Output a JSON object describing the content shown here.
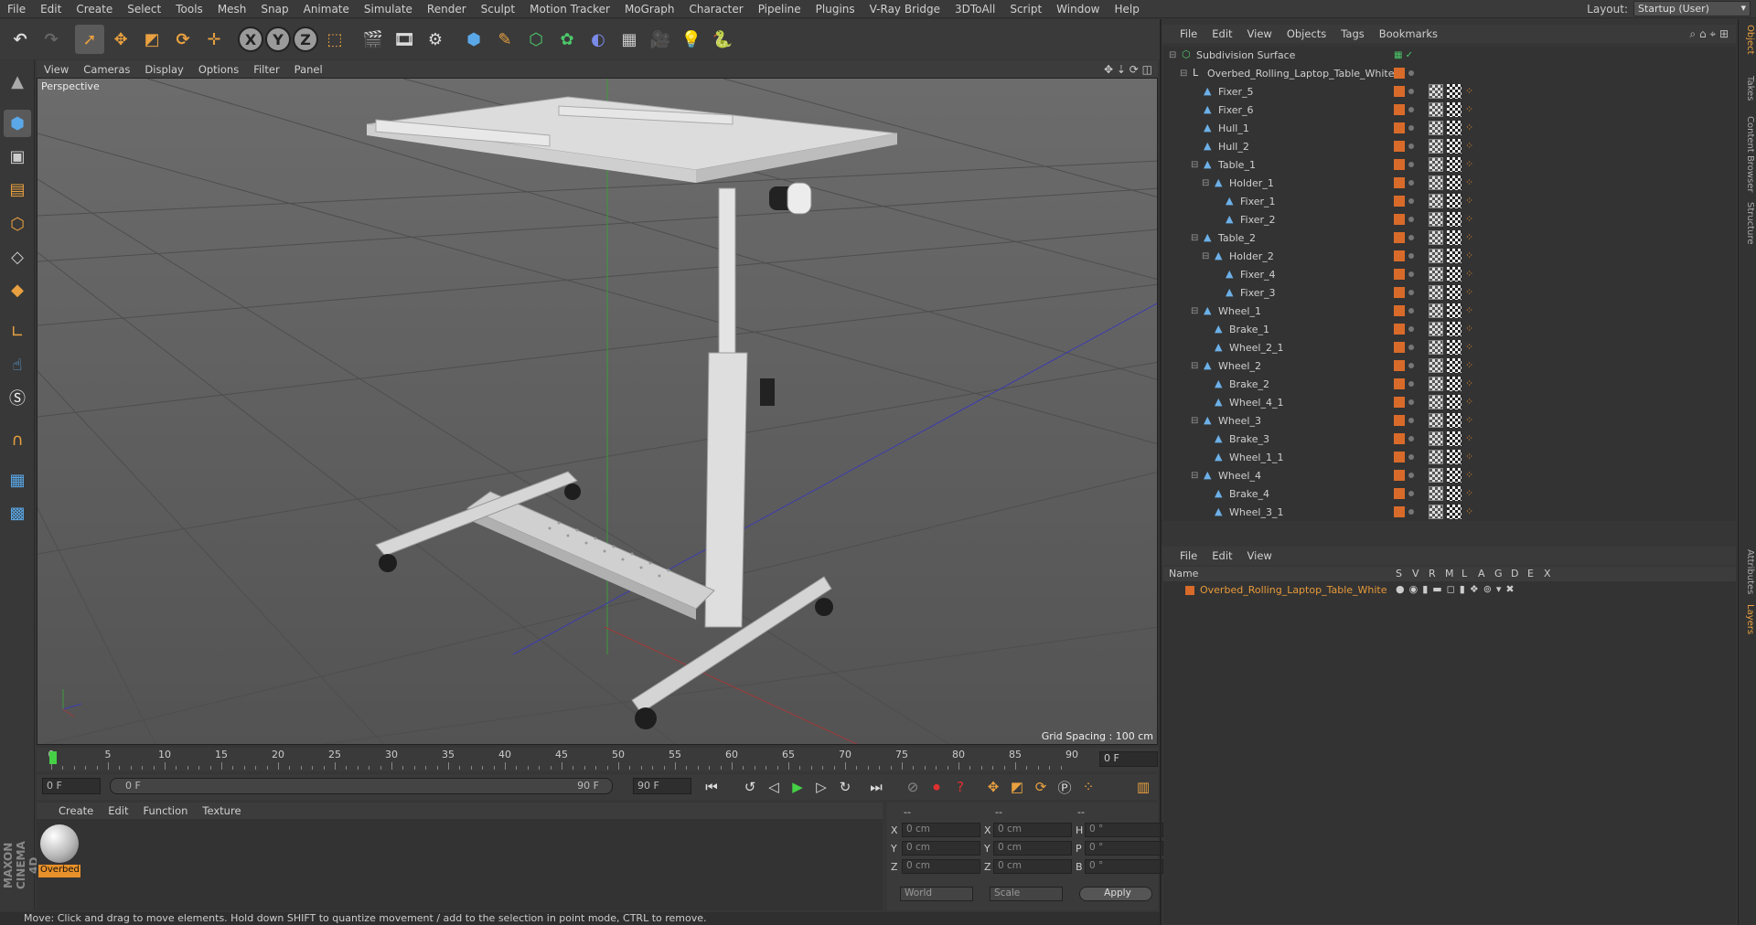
{
  "menubar": {
    "items": [
      "File",
      "Edit",
      "Create",
      "Select",
      "Tools",
      "Mesh",
      "Snap",
      "Animate",
      "Simulate",
      "Render",
      "Sculpt",
      "Motion Tracker",
      "MoGraph",
      "Character",
      "Pipeline",
      "Plugins",
      "V-Ray Bridge",
      "3DToAll",
      "Script",
      "Window",
      "Help"
    ],
    "layout_label": "Layout:",
    "layout_value": "Startup (User)"
  },
  "viewport": {
    "menu": [
      "View",
      "Cameras",
      "Display",
      "Options",
      "Filter",
      "Panel"
    ],
    "label": "Perspective",
    "grid_spacing": "Grid Spacing : 100 cm"
  },
  "timeline": {
    "ticks": [
      "0",
      "5",
      "10",
      "15",
      "20",
      "25",
      "30",
      "35",
      "40",
      "45",
      "50",
      "55",
      "60",
      "65",
      "70",
      "75",
      "80",
      "85",
      "90"
    ],
    "frame_end": "0 F"
  },
  "transport": {
    "current_frame": "0 F",
    "range_start": "0 F",
    "range_end": "90 F",
    "max_frame": "90 F"
  },
  "material_manager": {
    "menu": [
      "Create",
      "Edit",
      "Function",
      "Texture"
    ],
    "material_name": "Overbed"
  },
  "coordinates": {
    "header_a": "--",
    "header_b": "--",
    "header_c": "--",
    "x_pos": "0 cm",
    "y_pos": "0 cm",
    "z_pos": "0 cm",
    "x_size": "0 cm",
    "y_size": "0 cm",
    "z_size": "0 cm",
    "h_rot": "0 °",
    "p_rot": "0 °",
    "b_rot": "0 °",
    "labels": {
      "x": "X",
      "y": "Y",
      "z": "Z",
      "h": "H",
      "p": "P",
      "b": "B"
    },
    "mode_world": "World",
    "mode_scale": "Scale",
    "apply": "Apply"
  },
  "status": "Move: Click and drag to move elements. Hold down SHIFT to quantize movement / add to the selection in point mode, CTRL to remove.",
  "object_manager": {
    "menu": [
      "File",
      "Edit",
      "View",
      "Objects",
      "Tags",
      "Bookmarks"
    ],
    "objects": [
      {
        "name": "Subdivision Surface",
        "depth": 0
      },
      {
        "name": "Overbed_Rolling_Laptop_Table_White",
        "depth": 1
      },
      {
        "name": "Fixer_5",
        "depth": 2
      },
      {
        "name": "Fixer_6",
        "depth": 2
      },
      {
        "name": "Hull_1",
        "depth": 2
      },
      {
        "name": "Hull_2",
        "depth": 2
      },
      {
        "name": "Table_1",
        "depth": 2
      },
      {
        "name": "Holder_1",
        "depth": 3
      },
      {
        "name": "Fixer_1",
        "depth": 4
      },
      {
        "name": "Fixer_2",
        "depth": 4
      },
      {
        "name": "Table_2",
        "depth": 2
      },
      {
        "name": "Holder_2",
        "depth": 3
      },
      {
        "name": "Fixer_4",
        "depth": 4
      },
      {
        "name": "Fixer_3",
        "depth": 4
      },
      {
        "name": "Wheel_1",
        "depth": 2
      },
      {
        "name": "Brake_1",
        "depth": 3
      },
      {
        "name": "Wheel_2_1",
        "depth": 3
      },
      {
        "name": "Wheel_2",
        "depth": 2
      },
      {
        "name": "Brake_2",
        "depth": 3
      },
      {
        "name": "Wheel_4_1",
        "depth": 3
      },
      {
        "name": "Wheel_3",
        "depth": 2
      },
      {
        "name": "Brake_3",
        "depth": 3
      },
      {
        "name": "Wheel_1_1",
        "depth": 3
      },
      {
        "name": "Wheel_4",
        "depth": 2
      },
      {
        "name": "Brake_4",
        "depth": 3
      },
      {
        "name": "Wheel_3_1",
        "depth": 3
      }
    ]
  },
  "layer_manager": {
    "menu": [
      "File",
      "Edit",
      "View"
    ],
    "columns": [
      "Name",
      "S",
      "V",
      "R",
      "M",
      "L",
      "A",
      "G",
      "D",
      "E",
      "X"
    ],
    "layer_name": "Overbed_Rolling_Laptop_Table_White"
  },
  "right_tabs": [
    "Object",
    "Takes",
    "Content Browser",
    "Structure",
    "Attributes",
    "Layers"
  ],
  "colors": {
    "accent_orange": "#e8902a",
    "playhead_green": "#46d046",
    "layer_tag": "#d96b2a"
  }
}
